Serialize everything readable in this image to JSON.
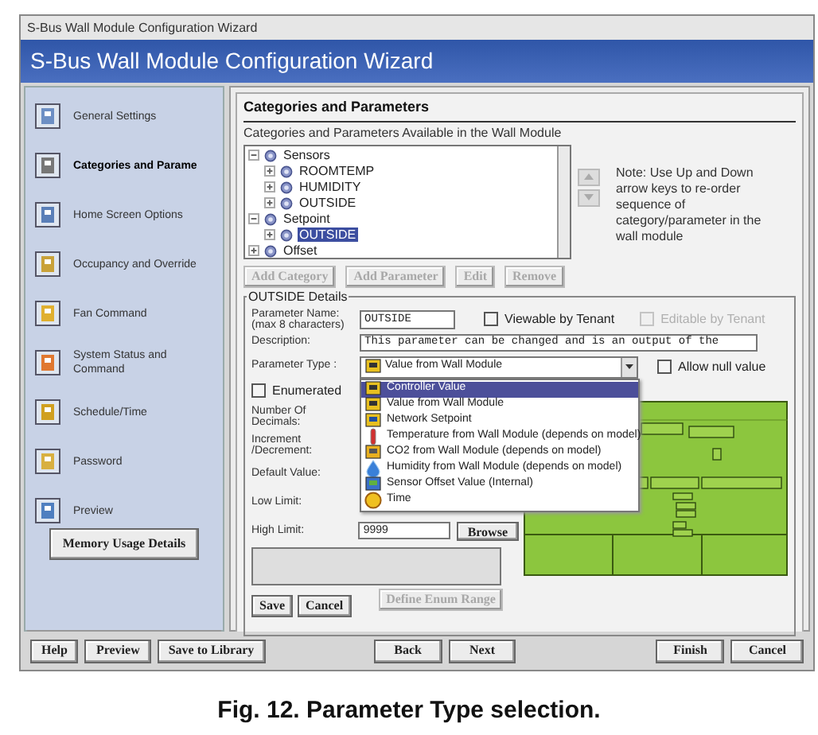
{
  "window": {
    "title": "S-Bus Wall Module Configuration Wizard"
  },
  "header": {
    "title": "S-Bus Wall Module Configuration Wizard"
  },
  "sidebar": {
    "items": [
      {
        "label": "General Settings",
        "selected": false
      },
      {
        "label": "Categories and Parame",
        "selected": true
      },
      {
        "label": "Home Screen Options",
        "selected": false
      },
      {
        "label": "Occupancy and Override",
        "selected": false
      },
      {
        "label": "Fan Command",
        "selected": false
      },
      {
        "label": "System Status and Command",
        "selected": false
      },
      {
        "label": "Schedule/Time",
        "selected": false
      },
      {
        "label": "Password",
        "selected": false
      },
      {
        "label": "Preview",
        "selected": false
      }
    ],
    "memory_button": "Memory Usage Details"
  },
  "section_title": "Categories and Parameters",
  "tree": {
    "label": "Categories and Parameters Available in the Wall Module",
    "items": [
      {
        "label": "Sensors",
        "expanded": true,
        "selected": false,
        "children": [
          {
            "label": "ROOMTEMP",
            "expanded": false,
            "selected": false
          },
          {
            "label": "HUMIDITY",
            "expanded": false,
            "selected": false
          },
          {
            "label": "OUTSIDE",
            "expanded": false,
            "selected": false
          }
        ]
      },
      {
        "label": "Setpoint",
        "expanded": true,
        "selected": false,
        "children": [
          {
            "label": "OUTSIDE",
            "expanded": false,
            "selected": true
          }
        ]
      },
      {
        "label": "Offset",
        "expanded": false,
        "selected": false
      }
    ]
  },
  "note": "Note: Use Up and Down arrow keys to re-order sequence of category/parameter in the wall module",
  "tree_buttons": [
    {
      "label": "Add Category",
      "disabled": true
    },
    {
      "label": "Add Parameter",
      "disabled": true
    },
    {
      "label": "Edit",
      "disabled": true
    },
    {
      "label": "Remove",
      "disabled": true
    }
  ],
  "details": {
    "legend": "OUTSIDE Details",
    "name_label": "Parameter Name:",
    "name_hint": "(max 8 characters)",
    "name_value": "OUTSIDE",
    "viewable": {
      "label": "Viewable by Tenant",
      "checked": false,
      "disabled": false
    },
    "editable": {
      "label": "Editable by Tenant",
      "checked": false,
      "disabled": true
    },
    "description_label": "Description:",
    "description_value": "This parameter can be changed and is an output of the",
    "type_label": "Parameter Type :",
    "type_value": "Value from Wall Module",
    "allow_null": {
      "label": "Allow null value",
      "checked": false,
      "disabled": false
    },
    "enumerated": {
      "label": "Enumerated",
      "checked": false,
      "disabled": false
    },
    "labels": [
      "Number Of Decimals:",
      "Increment /Decrement:",
      "Default Value:",
      "Low Limit:",
      "High Limit:"
    ],
    "high_limit_value": "9999",
    "browse_button": "Browse",
    "define_enum_button": "Define Enum Range",
    "save_button": "Save",
    "cancel_button": "Cancel"
  },
  "type_options": [
    {
      "label": "Controller Value",
      "selected": true
    },
    {
      "label": "Value from Wall Module",
      "selected": false
    },
    {
      "label": "Network Setpoint",
      "selected": false
    },
    {
      "label": "Temperature from Wall Module (depends on model)",
      "selected": false
    },
    {
      "label": "CO2 from Wall Module (depends on model)",
      "selected": false
    },
    {
      "label": "Humidity from Wall Module (depends on model)",
      "selected": false
    },
    {
      "label": "Sensor Offset Value (Internal)",
      "selected": false
    },
    {
      "label": "Time",
      "selected": false
    }
  ],
  "footer_buttons": {
    "left": [
      "Help",
      "Preview",
      "Save to Library"
    ],
    "middle": [
      "Back",
      "Next"
    ],
    "right": [
      "Finish",
      "Cancel"
    ]
  },
  "caption": "Fig. 12. Parameter Type selection."
}
